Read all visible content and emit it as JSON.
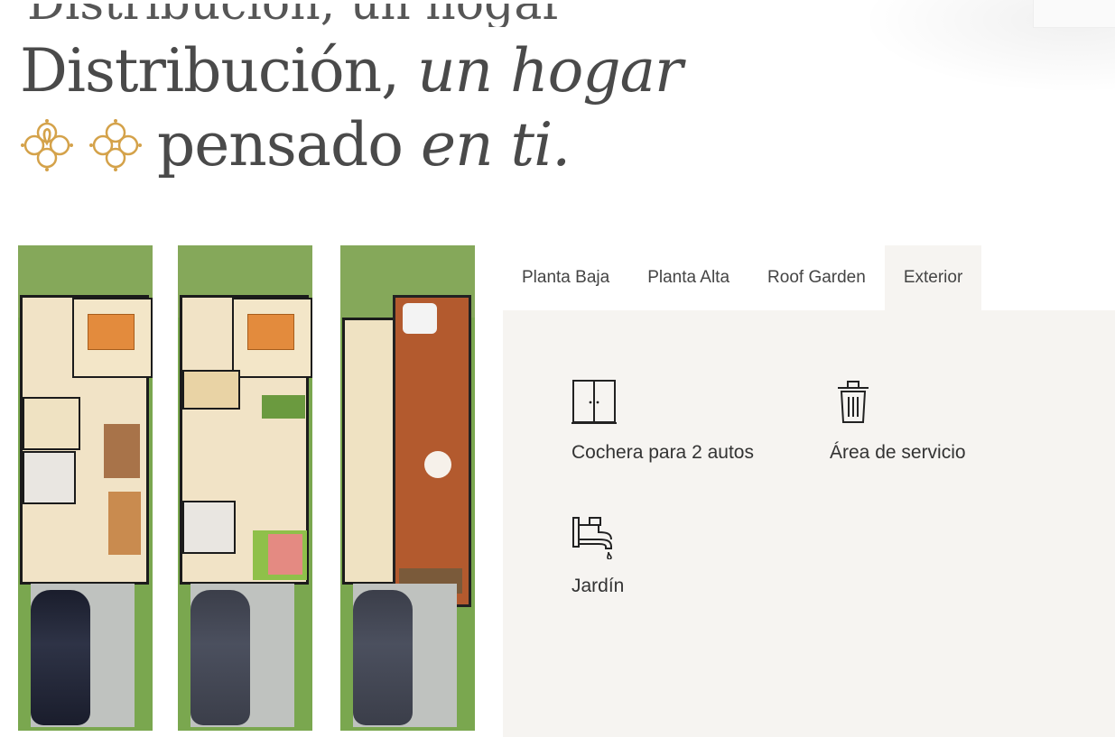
{
  "header": {
    "ghost_title": "Distribución, un hogar",
    "headline_plain_1": "Distribución,",
    "headline_italic_1": "un hogar",
    "headline_plain_2": "pensado",
    "headline_italic_2": "en ti."
  },
  "tabs": [
    {
      "label": "Planta Baja",
      "active": false
    },
    {
      "label": "Planta Alta",
      "active": false
    },
    {
      "label": "Roof Garden",
      "active": false
    },
    {
      "label": "Exterior",
      "active": true
    }
  ],
  "features": [
    {
      "label": "Cochera para 2 autos",
      "icon": "garage-door-icon"
    },
    {
      "label": "Área de servicio",
      "icon": "trash-bin-icon"
    },
    {
      "label": "Jardín",
      "icon": "faucet-icon"
    }
  ],
  "colors": {
    "accent_gold": "#d4a24a",
    "panel_bg": "#f6f4f1",
    "text_dark": "#4a4a4a"
  }
}
